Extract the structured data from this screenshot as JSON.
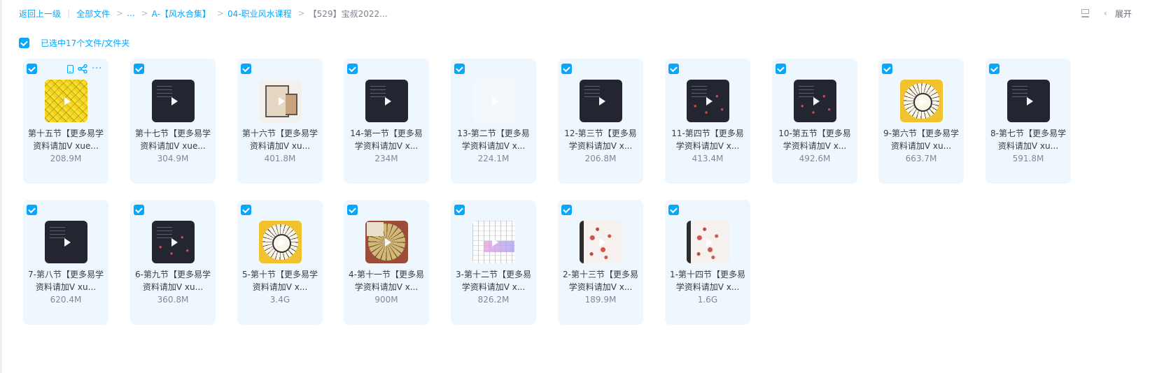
{
  "breadcrumb": {
    "back": "返回上一级",
    "all_files": "全部文件",
    "ellipsis": "...",
    "items": [
      "A-【风水合集】",
      "04-职业风水课程"
    ],
    "current": "【529】宝叔2022..."
  },
  "top_right": {
    "expand_label": "展开",
    "view_icon": "list-view-icon",
    "chevron_icon": "chevron-left-icon"
  },
  "selection": {
    "label": "已选中17个文件/文件夹",
    "checked": true
  },
  "colors": {
    "accent": "#06a7ff",
    "card_bg": "#eef7fe",
    "text": "#363d48",
    "muted": "#818999"
  },
  "files": [
    {
      "name": "第十五节【更多易学资料请加V xue...",
      "size": "208.9M",
      "thumb": "yellow"
    },
    {
      "name": "第十七节【更多易学资料请加V xue...",
      "size": "304.9M",
      "thumb": "dark"
    },
    {
      "name": "第十六节【更多易学资料请加V xu...",
      "size": "401.8M",
      "thumb": "floorplan"
    },
    {
      "name": "14-第一节【更多易学资料请加V x...",
      "size": "234M",
      "thumb": "dark"
    },
    {
      "name": "13-第二节【更多易学资料请加V x...",
      "size": "224.1M",
      "thumb": "faint"
    },
    {
      "name": "12-第三节【更多易学资料请加V x...",
      "size": "206.8M",
      "thumb": "dark"
    },
    {
      "name": "11-第四节【更多易学资料请加V x...",
      "size": "413.4M",
      "thumb": "dark-dots"
    },
    {
      "name": "10-第五节【更多易学资料请加V x...",
      "size": "492.6M",
      "thumb": "dark-dots"
    },
    {
      "name": "9-第六节【更多易学资料请加V xu...",
      "size": "663.7M",
      "thumb": "compass"
    },
    {
      "name": "8-第七节【更多易学资料请加V xu...",
      "size": "591.8M",
      "thumb": "dark"
    },
    {
      "name": "7-第八节【更多易学资料请加V xu...",
      "size": "620.4M",
      "thumb": "dark"
    },
    {
      "name": "6-第九节【更多易学资料请加V xu...",
      "size": "360.8M",
      "thumb": "dark-dots"
    },
    {
      "name": "5-第十节【更多易学资料请加V x...",
      "size": "3.4G",
      "thumb": "compass"
    },
    {
      "name": "4-第十一节【更多易学资料请加V x...",
      "size": "900M",
      "thumb": "compass2"
    },
    {
      "name": "3-第十二节【更多易学资料请加V x...",
      "size": "826.2M",
      "thumb": "table"
    },
    {
      "name": "2-第十三节【更多易学资料请加V x...",
      "size": "189.9M",
      "thumb": "redsketch"
    },
    {
      "name": "1-第十四节【更多易学资料请加V x...",
      "size": "1.6G",
      "thumb": "redsketch"
    }
  ]
}
